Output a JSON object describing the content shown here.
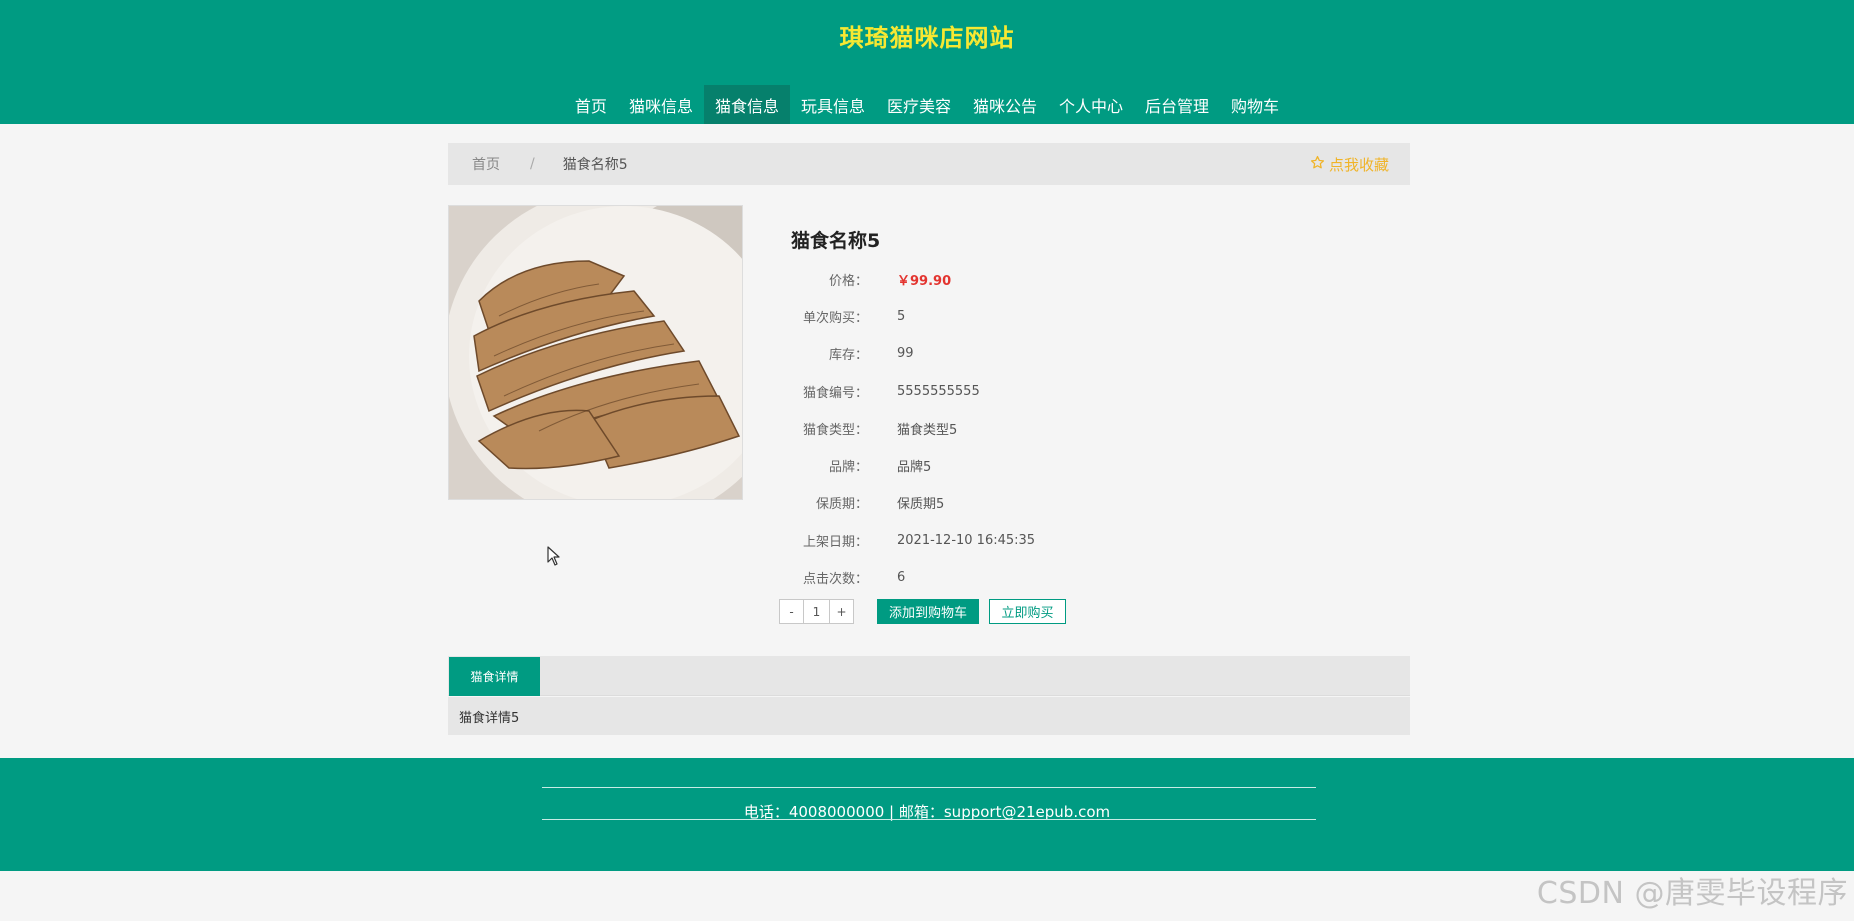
{
  "site": {
    "title": "琪琦猫咪店网站"
  },
  "nav": {
    "items": [
      {
        "label": "首页"
      },
      {
        "label": "猫咪信息"
      },
      {
        "label": "猫食信息",
        "active": true
      },
      {
        "label": "玩具信息"
      },
      {
        "label": "医疗美容"
      },
      {
        "label": "猫咪公告"
      },
      {
        "label": "个人中心"
      },
      {
        "label": "后台管理"
      },
      {
        "label": "购物车"
      }
    ]
  },
  "breadcrumb": {
    "home": "首页",
    "separator": "/",
    "current": "猫食名称5"
  },
  "favorite": {
    "label": "点我收藏",
    "icon": "star-outline-icon",
    "color": "#f0b429"
  },
  "product": {
    "name": "猫食名称5",
    "image_alt": "sliced-grilled-chicken-breast",
    "attributes": [
      {
        "label": "价格：",
        "value": "￥99.90"
      },
      {
        "label": "单次购买：",
        "value": "5"
      },
      {
        "label": "库存：",
        "value": "99"
      },
      {
        "label": "猫食编号：",
        "value": "5555555555"
      },
      {
        "label": "猫食类型：",
        "value": "猫食类型5"
      },
      {
        "label": "品牌：",
        "value": "品牌5"
      },
      {
        "label": "保质期：",
        "value": "保质期5"
      },
      {
        "label": "上架日期：",
        "value": "2021-12-10 16:45:35"
      },
      {
        "label": "点击次数：",
        "value": "6"
      }
    ]
  },
  "quantity": {
    "minus": "-",
    "value": "1",
    "plus": "+"
  },
  "actions": {
    "add_to_cart": "添加到购物车",
    "buy_now": "立即购买"
  },
  "tabs": {
    "active": "猫食详情",
    "content": "猫食详情5"
  },
  "footer": {
    "contact": "电话：4008000000 | 邮箱：support@21epub.com"
  },
  "watermark": "CSDN @唐雯毕设程序",
  "colors": {
    "primary": "#009b82",
    "title": "#f7e832",
    "price": "#e3342f"
  }
}
